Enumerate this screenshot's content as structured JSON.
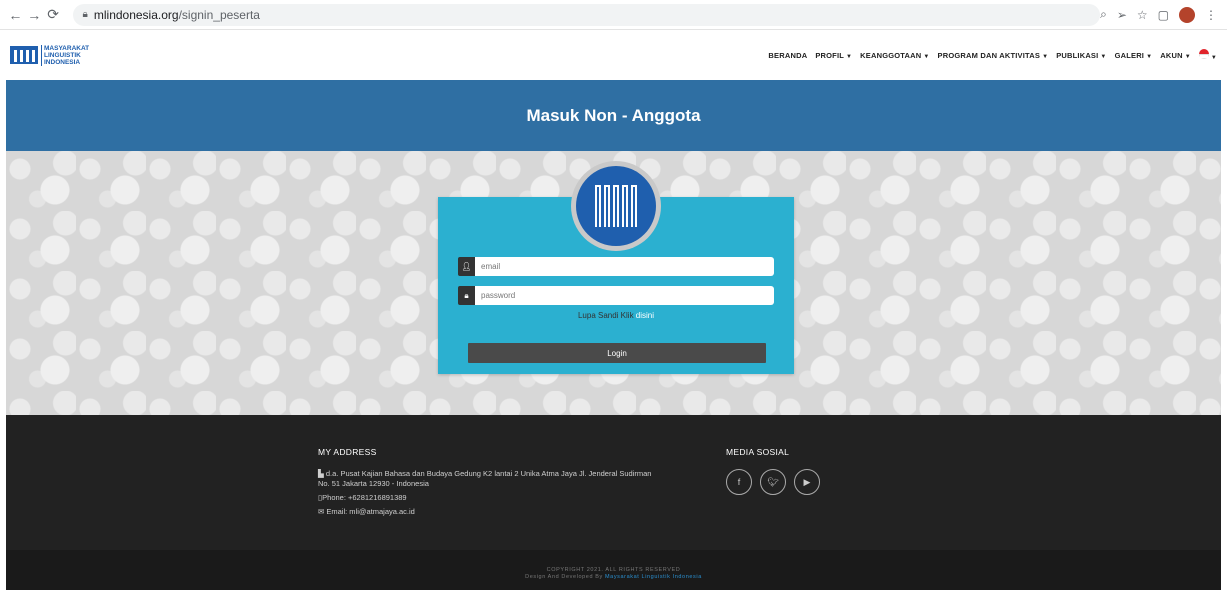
{
  "browser": {
    "url_domain": "mlindonesia.org",
    "url_path": "/signin_peserta"
  },
  "logo": {
    "line1": "MASYARAKAT",
    "line2": "LINGUISTIK",
    "line3": "INDONESIA"
  },
  "nav": {
    "items": [
      "BERANDA",
      "PROFIL",
      "KEANGGOTAAN",
      "PROGRAM DAN AKTIVITAS",
      "PUBLIKASI",
      "GALERI",
      "AKUN"
    ]
  },
  "page": {
    "title": "Masuk Non - Anggota"
  },
  "form": {
    "email_placeholder": "email",
    "password_placeholder": "password",
    "forgot_text": "Lupa Sandi Klik",
    "forgot_link": "disini",
    "login_label": "Login"
  },
  "footer": {
    "address_heading": "MY ADDRESS",
    "address_line1": "d.a. Pusat Kajian Bahasa dan Budaya Gedung K2 lantai 2 Unika Atma Jaya Jl. Jenderal Sudirman",
    "address_line2": "No. 51 Jakarta 12930 - Indonesia",
    "phone": "Phone: +6281216891389",
    "email": "Email: mli@atmajaya.ac.id",
    "social_heading": "MEDIA SOSIAL",
    "copyright": "COPYRIGHT 2021. ALL RIGHTS RESERVED",
    "developed_by": "Design And Developed By",
    "developer": "Maysarakat Linguistik Indonesia"
  },
  "colors": {
    "title_band": "#2f6fa3",
    "login_box": "#2bb0d0",
    "footer": "#222222"
  }
}
